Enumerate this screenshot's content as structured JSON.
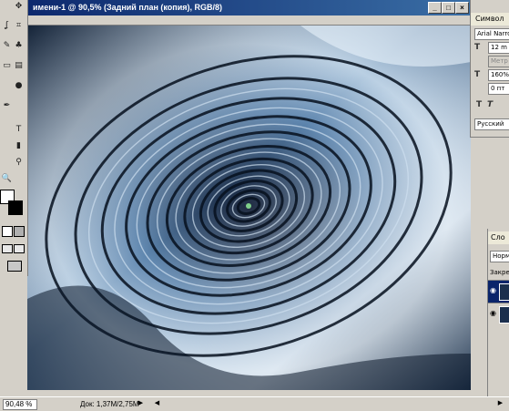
{
  "document": {
    "title": "имени-1 @ 90,5% (Задний план (копия), RGB/8)",
    "minimize": "_",
    "maximize": "□",
    "close": "×"
  },
  "status": {
    "zoom": "90,48 %",
    "doc_info": "Док: 1,37M/2,75M",
    "arrow_right": "▶",
    "arrow_left": "◀"
  },
  "tools": [
    {
      "name": "move-tool-icon",
      "glyph": "✥"
    },
    {
      "name": "lasso-tool-icon",
      "glyph": "ʆ"
    },
    {
      "name": "crop-tool-icon",
      "glyph": "⌗"
    },
    {
      "name": "brush-tool-icon",
      "glyph": "✎"
    },
    {
      "name": "stamp-tool-icon",
      "glyph": "♣"
    },
    {
      "name": "eraser-tool-icon",
      "glyph": "▭"
    },
    {
      "name": "gradient-tool-icon",
      "glyph": "▤"
    },
    {
      "name": "dodge-tool-icon",
      "glyph": "●"
    },
    {
      "name": "pen-tool-icon",
      "glyph": "✒"
    },
    {
      "name": "type-tool-icon",
      "glyph": "T"
    },
    {
      "name": "shape-tool-icon",
      "glyph": "▮"
    },
    {
      "name": "eyedropper-tool-icon",
      "glyph": "⚲"
    },
    {
      "name": "zoom-tool-icon",
      "glyph": "🔍"
    }
  ],
  "character_panel": {
    "tab": "Символ",
    "font": "Arial Narro",
    "size": "12 m",
    "leading": "Метр",
    "scale": "160%",
    "baseline": "0 пт",
    "language": "Русский",
    "style_T": "T",
    "style_italic": "T"
  },
  "layers_panel": {
    "tab": "Сло",
    "blend_mode": "Норм",
    "lock_label": "Закре"
  },
  "colors": {
    "title_bar": "#0a246a",
    "ui_gray": "#d4d0c8",
    "canvas_dark": "#07111f",
    "canvas_light": "#dfeaf4",
    "canvas_mid": "#5c84ad"
  }
}
